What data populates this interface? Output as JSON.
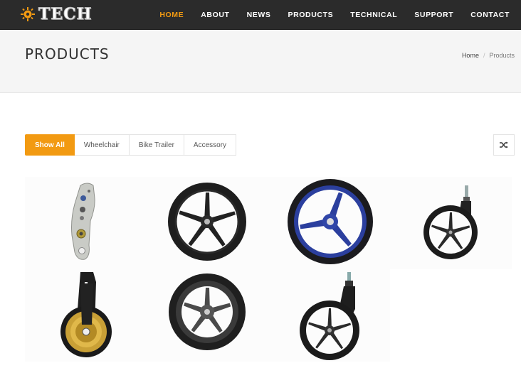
{
  "brand": {
    "name": "TECH"
  },
  "nav": {
    "items": [
      {
        "label": "HOME",
        "active": true
      },
      {
        "label": "ABOUT",
        "active": false
      },
      {
        "label": "NEWS",
        "active": false
      },
      {
        "label": "PRODUCTS",
        "active": false
      },
      {
        "label": "TECHNICAL",
        "active": false
      },
      {
        "label": "SUPPORT",
        "active": false
      },
      {
        "label": "CONTACT",
        "active": false
      }
    ]
  },
  "page": {
    "title": "PRODUCTS",
    "breadcrumb": {
      "home": "Home",
      "separator": "/",
      "current": "Products"
    }
  },
  "filters": {
    "items": [
      {
        "label": "Show All",
        "active": true
      },
      {
        "label": "Wheelchair",
        "active": false
      },
      {
        "label": "Bike Trailer",
        "active": false
      },
      {
        "label": "Accessory",
        "active": false
      }
    ],
    "shuffle_icon": "shuffle-icon"
  },
  "products": [
    {
      "image": "bracket-plate"
    },
    {
      "image": "black-5-spoke-wheel"
    },
    {
      "image": "blue-3-spoke-wheel"
    },
    {
      "image": "caster-wheel-with-stem"
    },
    {
      "image": "gold-caster-with-fork"
    },
    {
      "image": "gray-5-spoke-wheel"
    },
    {
      "image": "caster-wheel-black"
    }
  ],
  "colors": {
    "accent": "#f29a12",
    "topbar": "#2b2b2b",
    "header_band": "#f5f5f5"
  }
}
